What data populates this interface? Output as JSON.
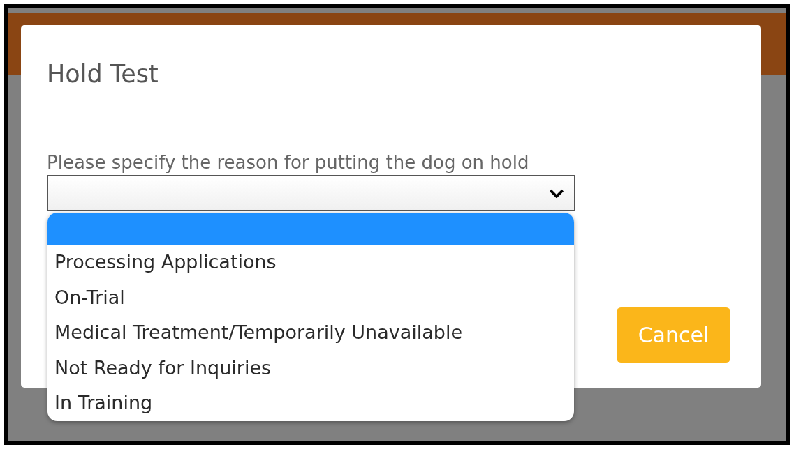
{
  "dialog": {
    "title": "Hold Test",
    "prompt": "Please specify the reason for putting the dog on hold",
    "select": {
      "expanded": true
    },
    "options": [
      {
        "selected": true
      },
      {
        "label": "Processing Applications",
        "selected": false
      },
      {
        "label": "On-Trial",
        "selected": false
      },
      {
        "label": "Medical Treatment/Temporarily Unavailable",
        "selected": false
      },
      {
        "label": "Not Ready for Inquiries",
        "selected": false
      },
      {
        "label": "In Training",
        "selected": false
      }
    ],
    "buttons": [
      {
        "label": "Cancel"
      }
    ]
  }
}
